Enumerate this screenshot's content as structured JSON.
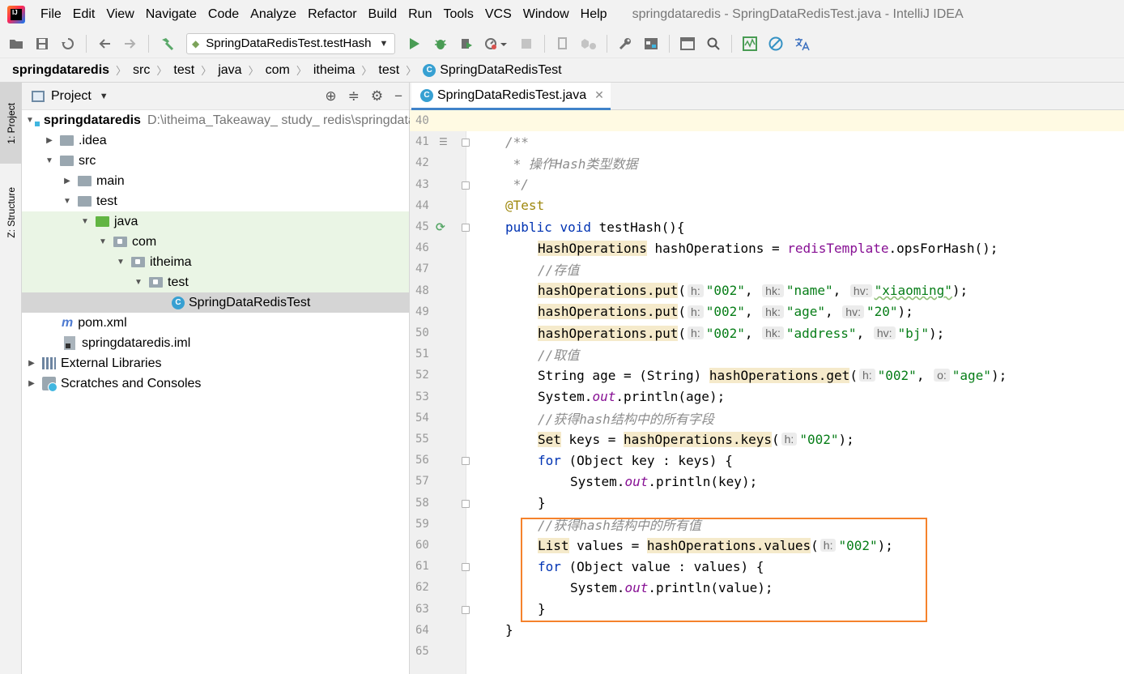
{
  "window": {
    "title": "springdataredis - SpringDataRedisTest.java - IntelliJ IDEA",
    "logo": "intellij-logo"
  },
  "menu": [
    "File",
    "Edit",
    "View",
    "Navigate",
    "Code",
    "Analyze",
    "Refactor",
    "Build",
    "Run",
    "Tools",
    "VCS",
    "Window",
    "Help"
  ],
  "toolbar": {
    "run_config": "SpringDataRedisTest.testHash",
    "icons": [
      "open-folder-icon",
      "save-icon",
      "sync-icon",
      "back-icon",
      "forward-icon",
      "build-hammer-icon",
      "run-icon",
      "debug-icon",
      "coverage-icon",
      "profile-icon",
      "stop-icon",
      "device-icon",
      "attach-icon",
      "settings-wrench-icon",
      "project-structure-icon",
      "terminal-icon",
      "search-icon",
      "activity-monitor-icon",
      "no-power-save-icon",
      "translate-icon"
    ]
  },
  "breadcrumb": [
    "springdataredis",
    "src",
    "test",
    "java",
    "com",
    "itheima",
    "test",
    "SpringDataRedisTest"
  ],
  "left_strip": {
    "project_tab": "1: Project",
    "structure_tab": "Z: Structure"
  },
  "project_panel": {
    "title": "Project",
    "tree": [
      {
        "label": "springdataredis",
        "path": "D:\\itheima_Takeaway_ study_ redis\\springdataredis"
      },
      {
        "label": ".idea"
      },
      {
        "label": "src"
      },
      {
        "label": "main"
      },
      {
        "label": "test"
      },
      {
        "label": "java"
      },
      {
        "label": "com"
      },
      {
        "label": "itheima"
      },
      {
        "label": "test"
      },
      {
        "label": "SpringDataRedisTest"
      },
      {
        "label": "pom.xml"
      },
      {
        "label": "springdataredis.iml"
      },
      {
        "label": "External Libraries"
      },
      {
        "label": "Scratches and Consoles"
      }
    ]
  },
  "editor": {
    "tab_label": "SpringDataRedisTest.java",
    "line_numbers": [
      "40",
      "41",
      "42",
      "43",
      "44",
      "45",
      "46",
      "47",
      "48",
      "49",
      "50",
      "51",
      "52",
      "53",
      "54",
      "55",
      "56",
      "57",
      "58",
      "59",
      "60",
      "61",
      "62",
      "63",
      "64",
      "65"
    ],
    "code": {
      "l41": "/**",
      "l42": " * 操作Hash类型数据",
      "l43": " */",
      "l44": "@Test",
      "l45_kw1": "public",
      "l45_kw2": "void",
      "l45_rest": " testHash(){",
      "l46_type": "HashOperations",
      "l46_mid": " hashOperations = ",
      "l46_field": "redisTemplate",
      "l46_end": ".opsForHash();",
      "l47": "//存值",
      "put_call": "hashOperations.put",
      "hint_h": "h:",
      "hint_hk": "hk:",
      "hint_hv": "hv:",
      "hint_o": "o:",
      "s002": "\"002\"",
      "l48_hk": "\"name\"",
      "l48_hv": "\"xiaoming\"",
      "l49_hk": "\"age\"",
      "l49_hv": "\"20\"",
      "l50_hk": "\"address\"",
      "l50_hv": "\"bj\"",
      "l51": "//取值",
      "l52_a": "String age = (String) ",
      "l52_call": "hashOperations.get",
      "l52_hk": "\"age\"",
      "sysout_a": "System.",
      "sysout_out": "out",
      "l53_end": ".println(age);",
      "l54": "//获得hash结构中的所有字段",
      "l55_type": "Set",
      "l55_mid": " keys = ",
      "l55_call": "hashOperations.keys",
      "kw_for": "for",
      "l56_rest": " (Object key : keys) {",
      "l57_end": ".println(key);",
      "close_brace": "}",
      "l59": "//获得hash结构中的所有值",
      "l60_type": "List",
      "l60_mid": " values = ",
      "l60_call": "hashOperations.values",
      "l61_rest": " (Object value : values) {",
      "l62_end": ".println(value);",
      "open_paren": "(",
      "comma": ", ",
      "close_call": ");"
    }
  },
  "colors": {
    "keyword": "#0033b3",
    "string": "#067d17",
    "comment": "#8c8c8c",
    "annotation": "#9e880d",
    "highlight_box": "#f5822c",
    "tab_underline": "#4083c9"
  }
}
